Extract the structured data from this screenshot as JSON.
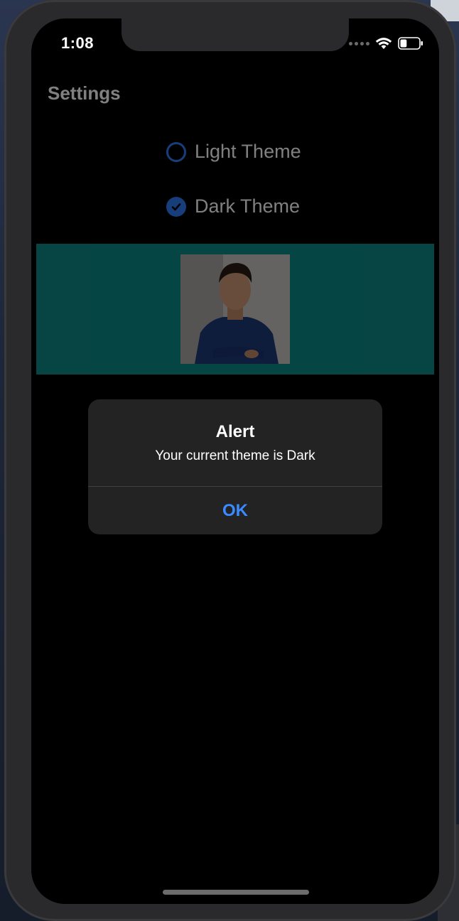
{
  "status_bar": {
    "time": "1:08",
    "battery_level": 0.35
  },
  "settings": {
    "title": "Settings",
    "options": [
      {
        "label": "Light Theme",
        "selected": false
      },
      {
        "label": "Dark Theme",
        "selected": true
      }
    ]
  },
  "banner": {
    "background_color": "#0b8a87",
    "image_icon": "profile-photo"
  },
  "alert": {
    "title": "Alert",
    "message": "Your current theme is Dark",
    "ok_label": "OK"
  },
  "colors": {
    "accent": "#2e7cf6",
    "alert_button": "#3a8bff",
    "background": "#000000"
  }
}
